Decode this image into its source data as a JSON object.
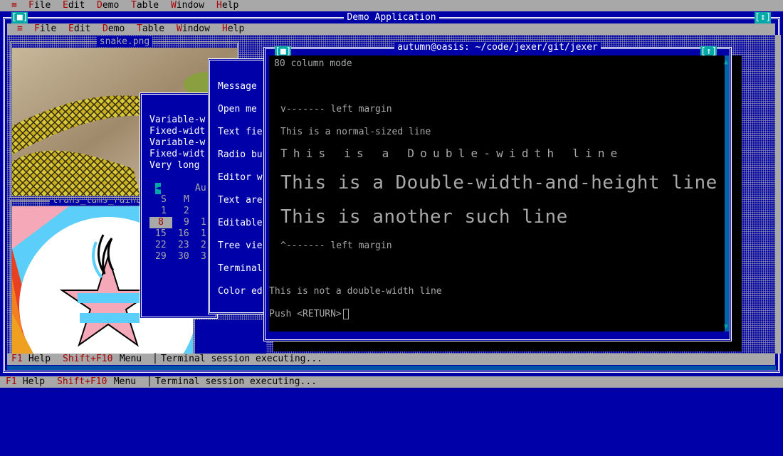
{
  "outer_menu": {
    "system": "≡",
    "items": [
      {
        "hot": "F",
        "rest": "ile"
      },
      {
        "hot": "E",
        "rest": "dit"
      },
      {
        "hot": "D",
        "rest": "emo"
      },
      {
        "hot": "T",
        "rest": "able"
      },
      {
        "hot": "W",
        "rest": "indow"
      },
      {
        "hot": "H",
        "rest": "elp"
      }
    ]
  },
  "app_window": {
    "title": "Demo Application",
    "close_btn": "[■]",
    "max_btn": "[↕]"
  },
  "inner_menu": {
    "system": "≡",
    "items": [
      {
        "hot": "F",
        "rest": "ile"
      },
      {
        "hot": "E",
        "rest": "dit"
      },
      {
        "hot": "D",
        "rest": "emo"
      },
      {
        "hot": "T",
        "rest": "able"
      },
      {
        "hot": "W",
        "rest": "indow"
      },
      {
        "hot": "H",
        "rest": "elp"
      }
    ]
  },
  "snake_window": {
    "title": "snake.png"
  },
  "rainbow_window": {
    "title": "trans_tams_rainbow"
  },
  "text_window": {
    "lines": [
      "Variable-w",
      "Fixed-widt",
      "Variable-w",
      "Fixed-widt",
      "Very long"
    ]
  },
  "calendar": {
    "month": "Au",
    "nav": "◄",
    "headers": [
      "S",
      "M"
    ],
    "rows": [
      [
        "1",
        "2",
        ""
      ],
      [
        "8",
        "9",
        "1"
      ],
      [
        "15",
        "16",
        "1"
      ],
      [
        "22",
        "23",
        "2"
      ],
      [
        "29",
        "30",
        "3"
      ]
    ],
    "selected": "8"
  },
  "demo_menu_window": {
    "items": [
      "Message",
      "Open me",
      "Text fie",
      "Radio bu",
      "Editor w",
      "Text are",
      "Editable",
      "Tree vie",
      "Terminal",
      "Color ed"
    ]
  },
  "terminal_window": {
    "title": "autumn@oasis: ~/code/jexer/git/jexer",
    "close_btn": "[■]",
    "max_btn": "[↑]",
    "line_mode": "80 column mode",
    "left_margin_top": "v------- left margin",
    "normal_line": "This is a normal-sized line",
    "double_width": "This is a Double-width line",
    "double_wh": "This is a Double-width-and-height line",
    "another": "This is another such line",
    "left_margin_bottom": "^------- left margin",
    "not_double": "This is not a double-width line",
    "push": "Push <RETURN>"
  },
  "inner_status": {
    "f1": "F1",
    "f1_label": " Help",
    "shift": "Shift+F10",
    "shift_label": " Menu",
    "sep": "│",
    "message": "Terminal session executing..."
  },
  "outer_status": {
    "f1": "F1",
    "f1_label": " Help",
    "shift": "Shift+F10",
    "shift_label": " Menu",
    "sep": "│",
    "message": "Terminal session executing..."
  },
  "colors": {
    "desktop": "#0000a8",
    "menu_bg": "#a8a8a8",
    "hotkey": "#a80000",
    "terminal_bg": "#000000",
    "terminal_fg": "#a8a8a8",
    "button": "#00a8a8"
  }
}
